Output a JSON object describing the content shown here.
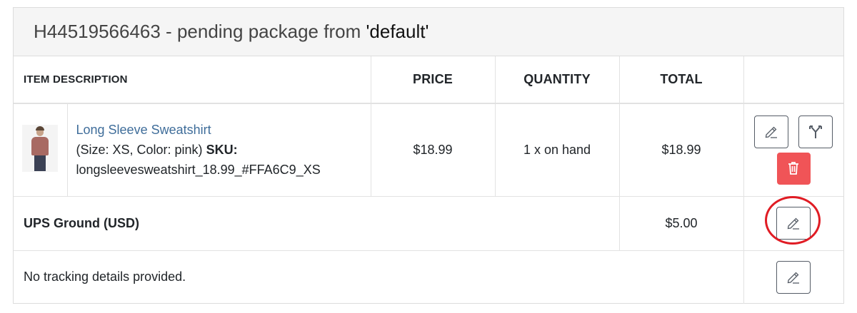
{
  "package": {
    "title_prefix": "H44519566463 - pending package from ",
    "store_name": "'default'"
  },
  "table": {
    "headers": {
      "description": "ITEM DESCRIPTION",
      "price": "PRICE",
      "quantity": "QUANTITY",
      "total": "TOTAL"
    },
    "item": {
      "name": "Long Sleeve Sweatshirt",
      "attributes": "(Size: XS, Color: pink) ",
      "sku_label": "SKU:",
      "sku": "longsleevesweatshirt_18.99_#FFA6C9_XS",
      "price": "$18.99",
      "quantity": "1 x on hand",
      "total": "$18.99"
    },
    "shipping": {
      "label": "UPS Ground (USD)",
      "total": "$5.00"
    },
    "tracking": {
      "label": "No tracking details provided."
    }
  },
  "icons": {
    "edit": "pencil-icon",
    "split": "split-arrows-icon",
    "delete": "trash-icon"
  },
  "colors": {
    "link": "#3f6d9a",
    "danger": "#f05457",
    "highlight_circle": "#e01c24"
  }
}
